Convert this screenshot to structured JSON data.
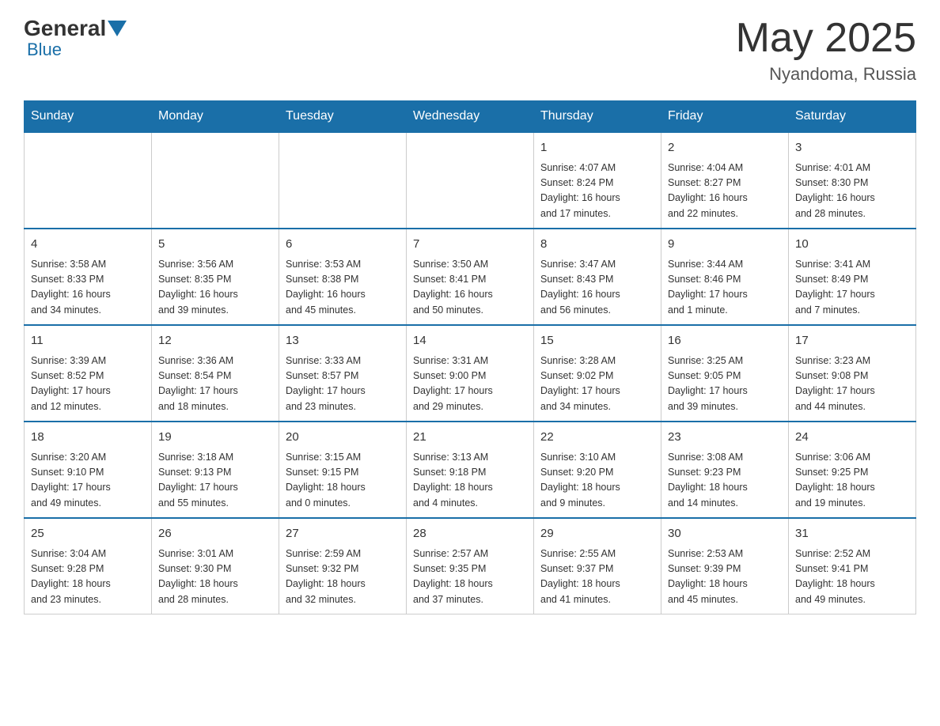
{
  "header": {
    "logo_general": "General",
    "logo_blue": "Blue",
    "month_year": "May 2025",
    "location": "Nyandoma, Russia"
  },
  "days_of_week": [
    "Sunday",
    "Monday",
    "Tuesday",
    "Wednesday",
    "Thursday",
    "Friday",
    "Saturday"
  ],
  "weeks": [
    [
      {
        "day": "",
        "info": ""
      },
      {
        "day": "",
        "info": ""
      },
      {
        "day": "",
        "info": ""
      },
      {
        "day": "",
        "info": ""
      },
      {
        "day": "1",
        "info": "Sunrise: 4:07 AM\nSunset: 8:24 PM\nDaylight: 16 hours\nand 17 minutes."
      },
      {
        "day": "2",
        "info": "Sunrise: 4:04 AM\nSunset: 8:27 PM\nDaylight: 16 hours\nand 22 minutes."
      },
      {
        "day": "3",
        "info": "Sunrise: 4:01 AM\nSunset: 8:30 PM\nDaylight: 16 hours\nand 28 minutes."
      }
    ],
    [
      {
        "day": "4",
        "info": "Sunrise: 3:58 AM\nSunset: 8:33 PM\nDaylight: 16 hours\nand 34 minutes."
      },
      {
        "day": "5",
        "info": "Sunrise: 3:56 AM\nSunset: 8:35 PM\nDaylight: 16 hours\nand 39 minutes."
      },
      {
        "day": "6",
        "info": "Sunrise: 3:53 AM\nSunset: 8:38 PM\nDaylight: 16 hours\nand 45 minutes."
      },
      {
        "day": "7",
        "info": "Sunrise: 3:50 AM\nSunset: 8:41 PM\nDaylight: 16 hours\nand 50 minutes."
      },
      {
        "day": "8",
        "info": "Sunrise: 3:47 AM\nSunset: 8:43 PM\nDaylight: 16 hours\nand 56 minutes."
      },
      {
        "day": "9",
        "info": "Sunrise: 3:44 AM\nSunset: 8:46 PM\nDaylight: 17 hours\nand 1 minute."
      },
      {
        "day": "10",
        "info": "Sunrise: 3:41 AM\nSunset: 8:49 PM\nDaylight: 17 hours\nand 7 minutes."
      }
    ],
    [
      {
        "day": "11",
        "info": "Sunrise: 3:39 AM\nSunset: 8:52 PM\nDaylight: 17 hours\nand 12 minutes."
      },
      {
        "day": "12",
        "info": "Sunrise: 3:36 AM\nSunset: 8:54 PM\nDaylight: 17 hours\nand 18 minutes."
      },
      {
        "day": "13",
        "info": "Sunrise: 3:33 AM\nSunset: 8:57 PM\nDaylight: 17 hours\nand 23 minutes."
      },
      {
        "day": "14",
        "info": "Sunrise: 3:31 AM\nSunset: 9:00 PM\nDaylight: 17 hours\nand 29 minutes."
      },
      {
        "day": "15",
        "info": "Sunrise: 3:28 AM\nSunset: 9:02 PM\nDaylight: 17 hours\nand 34 minutes."
      },
      {
        "day": "16",
        "info": "Sunrise: 3:25 AM\nSunset: 9:05 PM\nDaylight: 17 hours\nand 39 minutes."
      },
      {
        "day": "17",
        "info": "Sunrise: 3:23 AM\nSunset: 9:08 PM\nDaylight: 17 hours\nand 44 minutes."
      }
    ],
    [
      {
        "day": "18",
        "info": "Sunrise: 3:20 AM\nSunset: 9:10 PM\nDaylight: 17 hours\nand 49 minutes."
      },
      {
        "day": "19",
        "info": "Sunrise: 3:18 AM\nSunset: 9:13 PM\nDaylight: 17 hours\nand 55 minutes."
      },
      {
        "day": "20",
        "info": "Sunrise: 3:15 AM\nSunset: 9:15 PM\nDaylight: 18 hours\nand 0 minutes."
      },
      {
        "day": "21",
        "info": "Sunrise: 3:13 AM\nSunset: 9:18 PM\nDaylight: 18 hours\nand 4 minutes."
      },
      {
        "day": "22",
        "info": "Sunrise: 3:10 AM\nSunset: 9:20 PM\nDaylight: 18 hours\nand 9 minutes."
      },
      {
        "day": "23",
        "info": "Sunrise: 3:08 AM\nSunset: 9:23 PM\nDaylight: 18 hours\nand 14 minutes."
      },
      {
        "day": "24",
        "info": "Sunrise: 3:06 AM\nSunset: 9:25 PM\nDaylight: 18 hours\nand 19 minutes."
      }
    ],
    [
      {
        "day": "25",
        "info": "Sunrise: 3:04 AM\nSunset: 9:28 PM\nDaylight: 18 hours\nand 23 minutes."
      },
      {
        "day": "26",
        "info": "Sunrise: 3:01 AM\nSunset: 9:30 PM\nDaylight: 18 hours\nand 28 minutes."
      },
      {
        "day": "27",
        "info": "Sunrise: 2:59 AM\nSunset: 9:32 PM\nDaylight: 18 hours\nand 32 minutes."
      },
      {
        "day": "28",
        "info": "Sunrise: 2:57 AM\nSunset: 9:35 PM\nDaylight: 18 hours\nand 37 minutes."
      },
      {
        "day": "29",
        "info": "Sunrise: 2:55 AM\nSunset: 9:37 PM\nDaylight: 18 hours\nand 41 minutes."
      },
      {
        "day": "30",
        "info": "Sunrise: 2:53 AM\nSunset: 9:39 PM\nDaylight: 18 hours\nand 45 minutes."
      },
      {
        "day": "31",
        "info": "Sunrise: 2:52 AM\nSunset: 9:41 PM\nDaylight: 18 hours\nand 49 minutes."
      }
    ]
  ]
}
